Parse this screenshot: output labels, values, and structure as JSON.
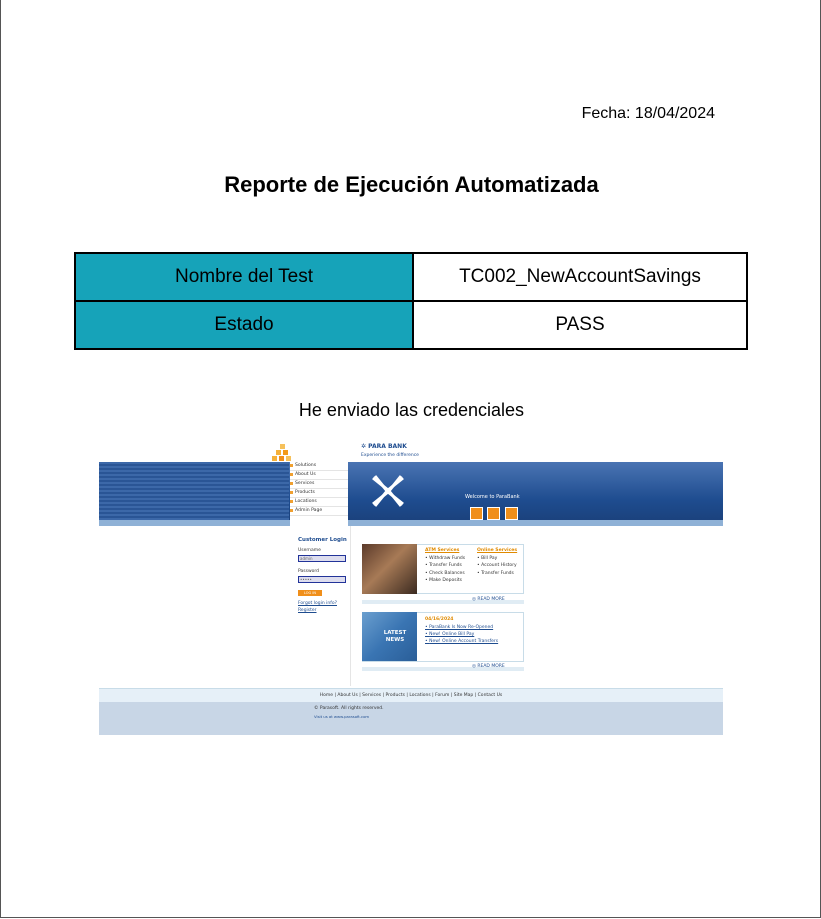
{
  "report": {
    "date": "Fecha: 18/04/2024",
    "title": "Reporte de Ejecución Automatizada",
    "rows": [
      {
        "label": "Nombre del Test",
        "value": "TC002_NewAccountSavings"
      },
      {
        "label": "Estado",
        "value": "PASS"
      }
    ],
    "caption": "He enviado las credenciales",
    "accent_color": "#16a3b9"
  },
  "screenshot": {
    "brand": "PARA BANK",
    "tagline": "Experience the difference",
    "menu": [
      "Solutions",
      "About Us",
      "Services",
      "Products",
      "Locations",
      "Admin Page"
    ],
    "welcome": "Welcome to ParaBank",
    "login": {
      "title": "Customer Login",
      "username_label": "Username",
      "username_value": "admin",
      "password_label": "Password",
      "password_value": "•••••",
      "button": "LOG IN",
      "forgot": "Forgot login info?",
      "register": "Register"
    },
    "atm_services": {
      "heading": "ATM Services",
      "items": [
        "Withdraw Funds",
        "Transfer Funds",
        "Check Balances",
        "Make Deposits"
      ]
    },
    "online_services": {
      "heading": "Online Services",
      "items": [
        "Bill Pay",
        "Account History",
        "Transfer Funds"
      ]
    },
    "read_more": "READ MORE",
    "latest_news": "LATEST NEWS",
    "news": {
      "date": "04/16/2024",
      "items": [
        "ParaBank Is Now Re-Opened",
        "New! Online Bill Pay",
        "New! Online Account Transfers"
      ]
    },
    "footer_links": "Home | About Us | Services | Products | Locations | Forum | Site Map | Contact Us",
    "copyright": "© Parasoft. All rights reserved.",
    "visit": "Visit us at www.parasoft.com"
  }
}
